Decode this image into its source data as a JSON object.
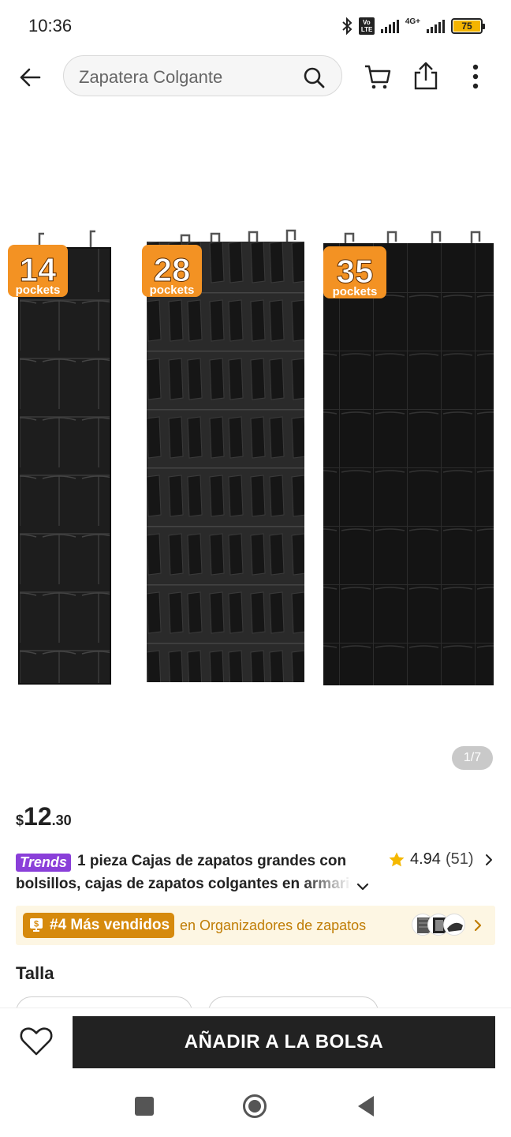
{
  "status_bar": {
    "time": "10:36",
    "network": "4G+",
    "battery": "75"
  },
  "header": {
    "search_text": "Zapatera Colgante",
    "icons": [
      "back-arrow-icon",
      "search-icon",
      "cart-icon",
      "share-icon",
      "more-vertical-icon"
    ]
  },
  "product_image": {
    "badges": [
      "14",
      "28",
      "35"
    ],
    "badge_suffix": "pockets",
    "counter": "1/7"
  },
  "price": {
    "currency": "$",
    "integer": "12",
    "decimal": ".30"
  },
  "title": {
    "badge": "Trends",
    "line1": "1 pieza Cajas de zapatos grandes con",
    "line2": "bolsillos, cajas de zapatos colgantes en armario"
  },
  "rating": {
    "score": "4.94",
    "count": "(51)"
  },
  "bestseller": {
    "tag": "#4 Más vendidos",
    "category": "en Organizadores de zapatos"
  },
  "size": {
    "label": "Talla"
  },
  "actions": {
    "add_to_bag": "AÑADIR A LA BOLSA"
  },
  "colors": {
    "accent_dark": "#222222",
    "bestseller_bg": "#fdf6e3",
    "bestseller_tag": "#d68a0d",
    "trends_badge": "#8a3fd9",
    "pocket_badge": "#f39223"
  }
}
